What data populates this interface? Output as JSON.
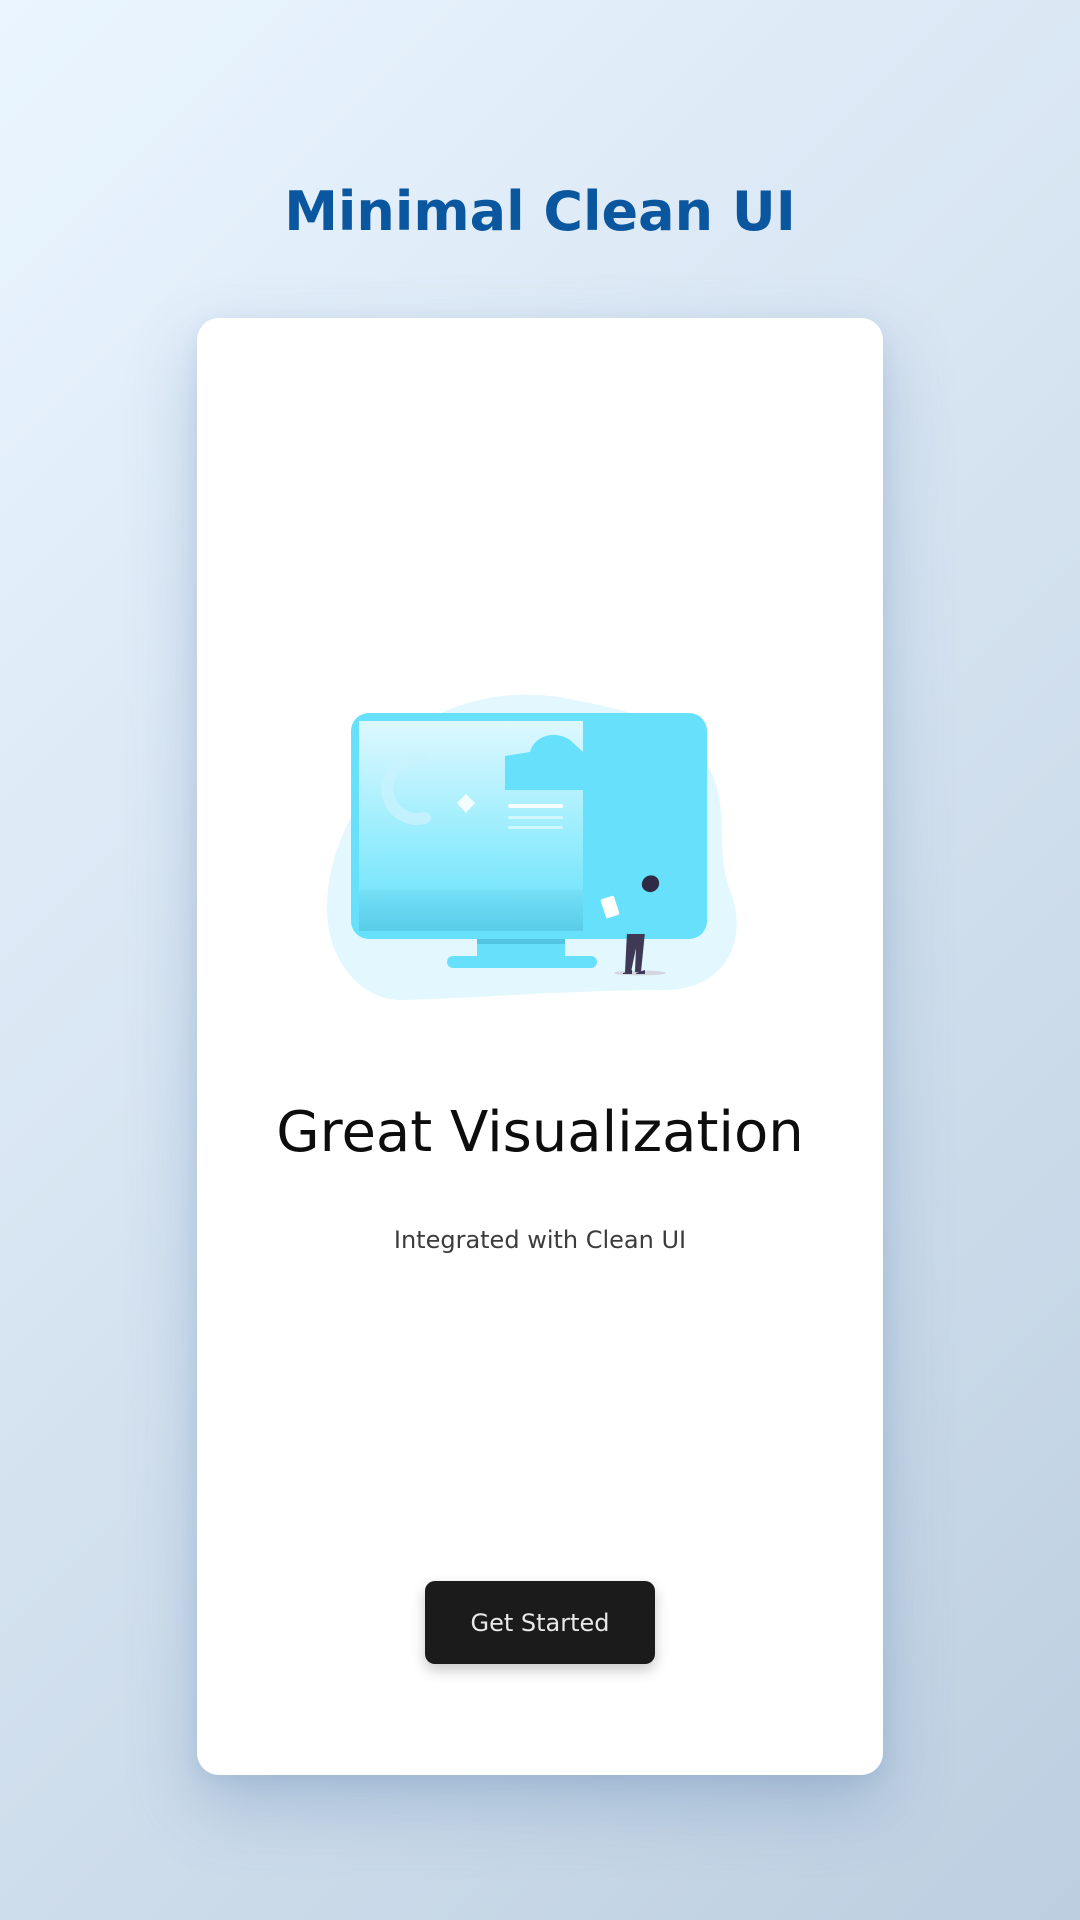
{
  "header": {
    "title": "Minimal Clean UI"
  },
  "card": {
    "illustration_icon": "monitor-with-person-illustration",
    "headline": "Great Visualization",
    "subtitle": "Integrated with Clean UI",
    "cta_label": "Get Started"
  },
  "colors": {
    "title": "#0a579f",
    "accent": "#66e0fb",
    "button_bg": "#1b1b1b",
    "card_bg": "#ffffff"
  }
}
